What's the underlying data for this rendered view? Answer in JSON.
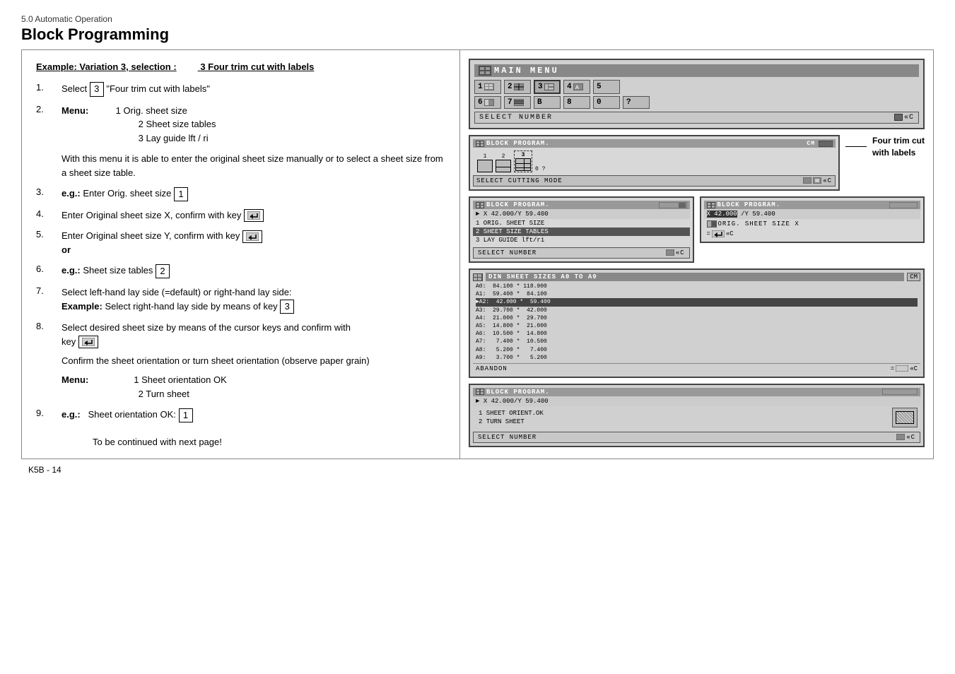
{
  "page": {
    "section": "5.0 Automatic Operation",
    "title": "Block Programming",
    "footer": "K5B - 14"
  },
  "example": {
    "title_left": "Example: Variation 3, selection :",
    "title_right": "3 Four trim cut with labels"
  },
  "steps": [
    {
      "num": "1.",
      "content_type": "select",
      "label": "Select",
      "box_value": "3",
      "suffix": "\"Four trim cut with labels\""
    },
    {
      "num": "2.",
      "content_type": "menu",
      "label": "Menu:",
      "menu_items": [
        "1 Orig. sheet size",
        "2 Sheet size tables",
        "3 Lay guide lft / ri"
      ]
    },
    {
      "num": "",
      "content_type": "info",
      "text": "With this menu it is able to enter the original sheet size manually or to select a sheet size from a sheet size table."
    },
    {
      "num": "3.",
      "content_type": "eg",
      "label": "e.g.:",
      "text": "Enter Orig. sheet size",
      "box_value": "1"
    },
    {
      "num": "4.",
      "content_type": "enter",
      "text": "Enter Original sheet size X, confirm with key"
    },
    {
      "num": "5.",
      "content_type": "enter",
      "text": "Enter Original sheet size Y, confirm with key",
      "or": true
    },
    {
      "num": "6.",
      "content_type": "eg",
      "label": "e.g.:",
      "text": "Sheet size tables",
      "box_value": "2"
    },
    {
      "num": "7.",
      "content_type": "layguide",
      "text": "Select left-hand lay side (=default) or right-hand lay side:",
      "example": "Select right-hand lay side by means of key",
      "box_value": "3"
    },
    {
      "num": "8.",
      "content_type": "cursor",
      "text": "Select desired sheet size by means of the cursor keys and confirm with",
      "key_text": "key"
    },
    {
      "num": "",
      "content_type": "confirm",
      "text": "Confirm the sheet orientation or turn sheet orientation (observe paper grain)"
    },
    {
      "num": "",
      "content_type": "menu2",
      "label": "Menu:",
      "menu_items": [
        "1 Sheet orientation OK",
        "2 Turn sheet"
      ]
    },
    {
      "num": "9.",
      "content_type": "eg2",
      "label": "e.g.:",
      "text": "Sheet orientation OK:",
      "box_value": "1"
    }
  ],
  "continued": "To be continued with next page!",
  "screens": {
    "main_menu_title": "MAIN MENU",
    "select_number": "SELECT NUMBER",
    "block_program": "BLOCK PROGRAM.",
    "select_cutting_mode": "SELECT CUTTING MODE",
    "select_number2": "SELECT NUMBER",
    "din_header": "DIN SHEET SIZES A0 TO A9",
    "coord": "X 42.000/Y 59.400",
    "orig_sheet_size": "1 ORIG. SHEET SIZE",
    "sheet_size_tables": "2 SHEET SIZE TABLES",
    "lay_guide": "3 LAY GUIDE ...",
    "orig_sheet_size_x": "ORIG. SHEET SIZE X",
    "abandon": "ABANDON",
    "sheet_orient_ok": "1 SHEET ORIENT.OK",
    "turn_sheet": "2 TURN SHEET",
    "select_number3": "SELECT NUMBER",
    "four_trim_label": "Four trim cut\nwith labels",
    "din_unit": "CM",
    "din_rows": [
      "A0:  84.100 * 118.900",
      "A1:  59.400 * 84.100",
      "A2:  42.000 * 59.400",
      "A3:  29.700 * 42.000",
      "A4:  21.000 * 29.700",
      "A5:  14.800 * 21.000",
      "A6:  10.500 * 14.800",
      "A7:   7.400 * 10.500",
      "A8:   5.200 *  7.400",
      "A9:   3.700 *  5.200"
    ],
    "din_highlighted": "A2:  42.000 * 59.400"
  }
}
